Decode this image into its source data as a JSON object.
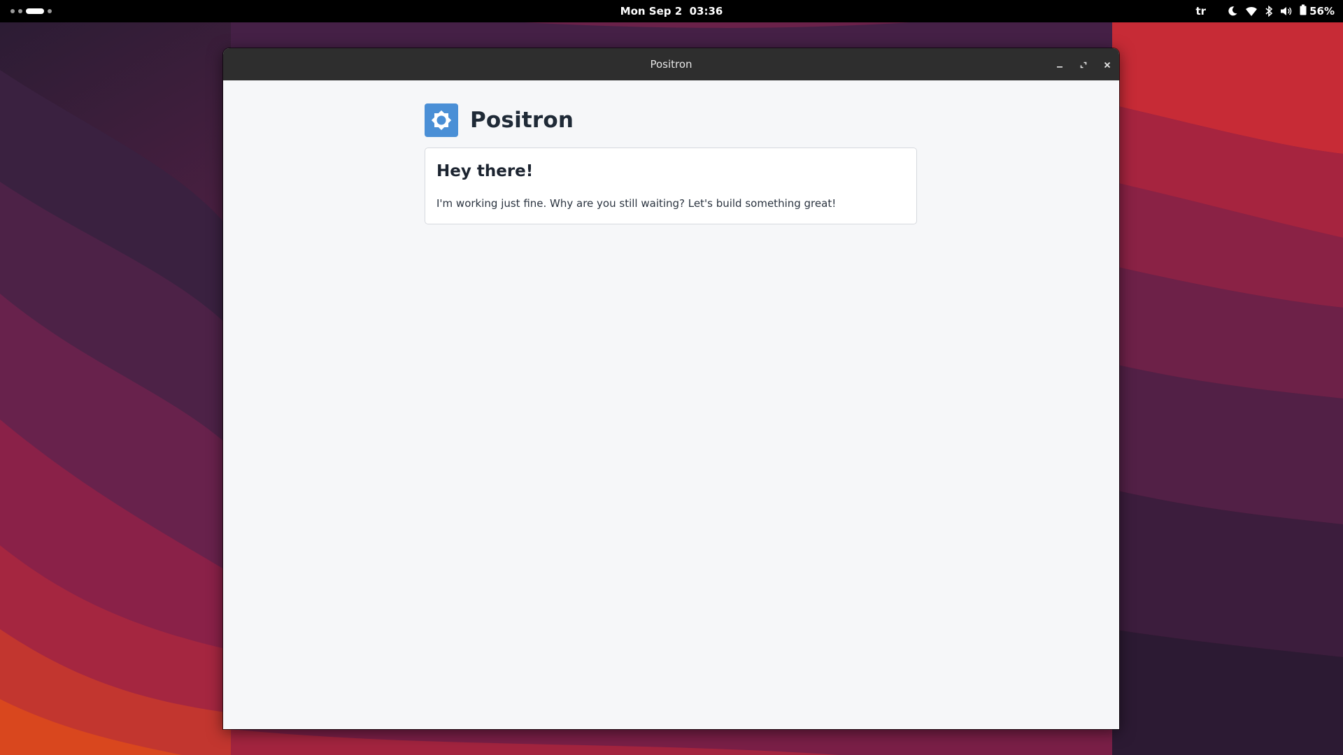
{
  "topbar": {
    "clock": "Mon Sep 2  03:36",
    "keyboard_layout": "tr",
    "battery_percent": "56%",
    "icons": [
      "night-light-icon",
      "wifi-icon",
      "bluetooth-icon",
      "volume-icon",
      "battery-icon"
    ]
  },
  "window": {
    "title": "Positron",
    "controls": [
      "minimize",
      "maximize",
      "close"
    ]
  },
  "app": {
    "name": "Positron",
    "logo_icon": "positron-logo-icon",
    "card": {
      "heading": "Hey there!",
      "message": "I'm working just fine. Why are you still waiting? Let's build something great!"
    }
  },
  "colors": {
    "topbar_bg": "#000000",
    "titlebar_bg": "#2e2e2e",
    "content_bg": "#f6f7f9",
    "logo_blue": "#4a8fd6",
    "text_dark": "#1f2a37"
  }
}
